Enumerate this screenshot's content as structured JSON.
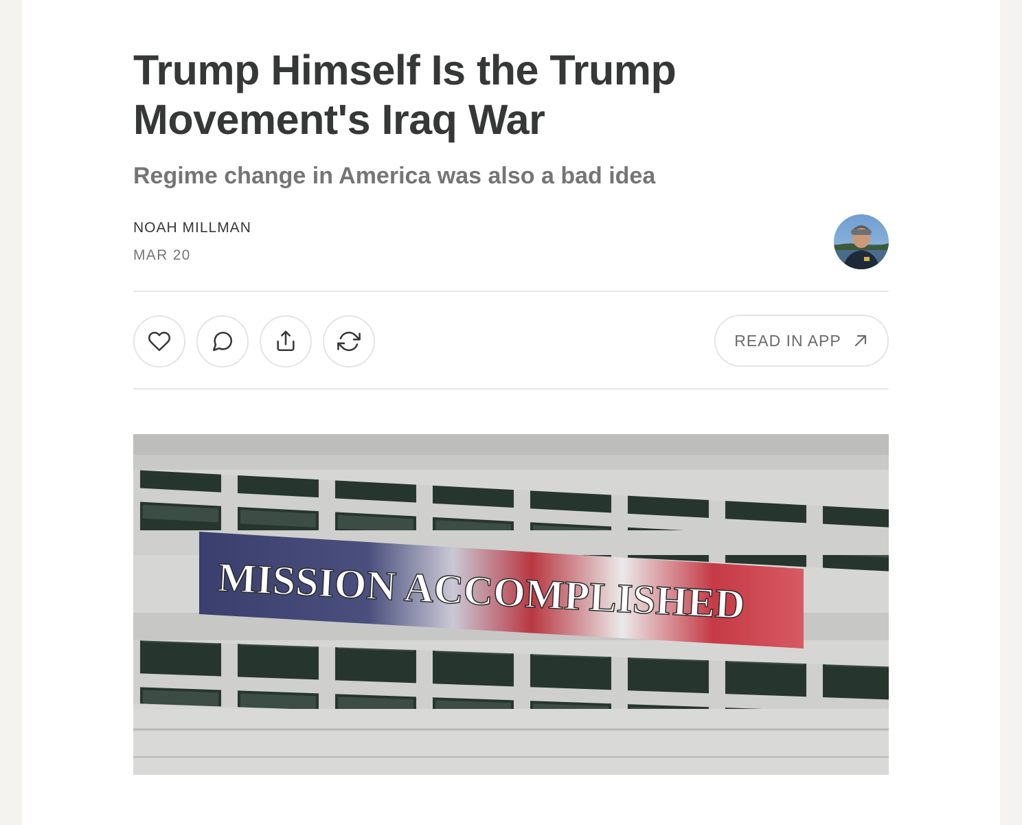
{
  "post": {
    "title": "Trump Himself Is the Trump Movement's Iraq War",
    "subtitle": "Regime change in America was also a bad idea",
    "author": "NOAH MILLMAN",
    "date": "MAR 20"
  },
  "actions": {
    "read_in_app": "READ IN APP",
    "icons": [
      "heart-icon",
      "comment-icon",
      "share-icon",
      "restack-icon",
      "arrow-up-right-icon"
    ]
  },
  "hero": {
    "banner_text": "MISSION ACCOMPLISHED"
  },
  "colors": {
    "title": "#363737",
    "muted": "#757575",
    "border": "#e4e4e4",
    "page_bg": "#f4f3f0"
  }
}
